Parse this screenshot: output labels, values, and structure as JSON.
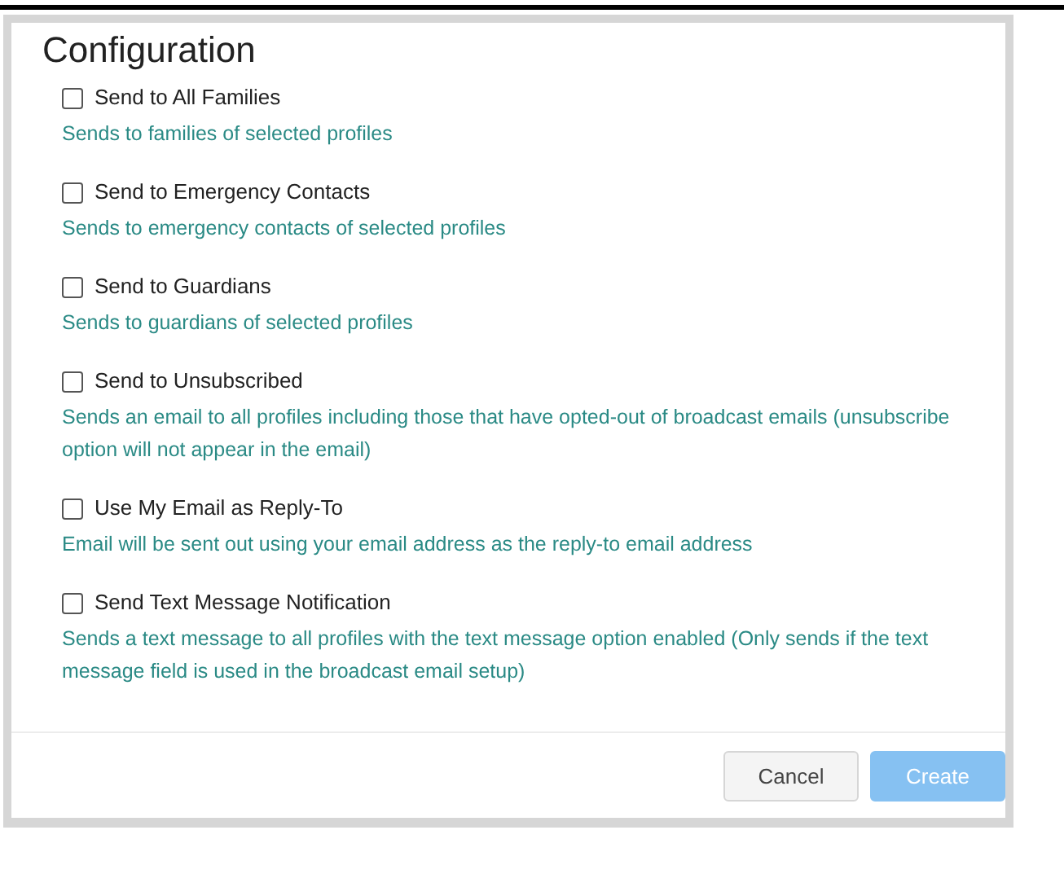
{
  "title": "Configuration",
  "options": [
    {
      "label": "Send to All Families",
      "description": "Sends to families of selected profiles",
      "checked": false
    },
    {
      "label": "Send to Emergency Contacts",
      "description": "Sends to emergency contacts of selected profiles",
      "checked": false
    },
    {
      "label": "Send to Guardians",
      "description": "Sends to guardians of selected profiles",
      "checked": false
    },
    {
      "label": "Send to Unsubscribed",
      "description": "Sends an email to all profiles including those that have opted-out of broadcast emails (unsubscribe option will not appear in the email)",
      "checked": false
    },
    {
      "label": "Use My Email as Reply-To",
      "description": "Email will be sent out using your email address as the reply-to email address",
      "checked": false
    },
    {
      "label": "Send Text Message Notification",
      "description": "Sends a text message to all profiles with the text message option enabled (Only sends if the text message field is used in the broadcast email setup)",
      "checked": false
    }
  ],
  "buttons": [
    {
      "label": "Cancel",
      "kind": "secondary",
      "disabled": false
    },
    {
      "label": "Create",
      "kind": "primary",
      "disabled": true
    }
  ]
}
